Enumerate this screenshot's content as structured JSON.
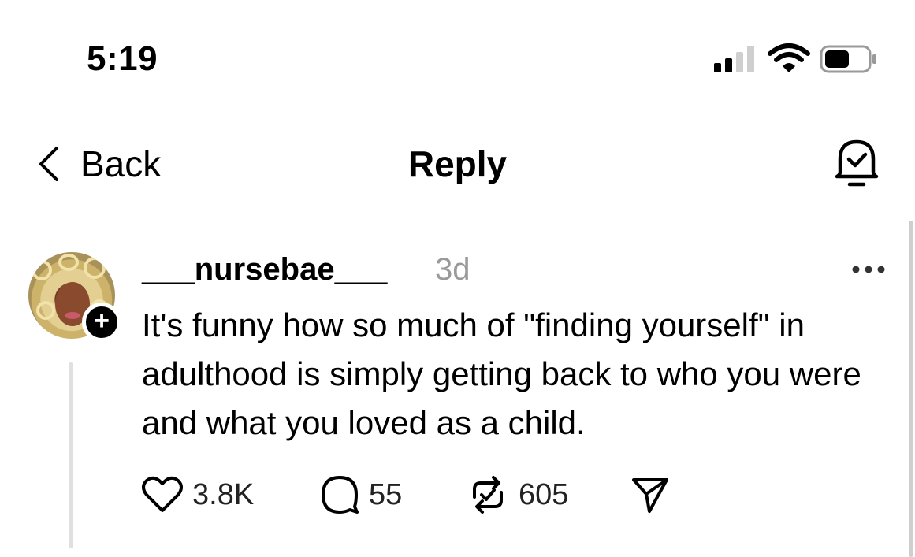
{
  "status_bar": {
    "time": "5:19",
    "icons": [
      "cellular-signal-icon",
      "wifi-icon",
      "battery-icon"
    ]
  },
  "nav": {
    "back_label": "Back",
    "title": "Reply",
    "right_icon": "notification-bell-check-icon"
  },
  "post": {
    "username": "___nursebae___",
    "time_ago": "3d",
    "text": "It's funny how so much of \"finding yourself\" in adulthood is simply getting back to who you were and what you loved as a child.",
    "likes": "3.8K",
    "replies": "55",
    "reposts": "605",
    "follow_badge": "+"
  },
  "colors": {
    "text": "#000000",
    "muted": "#9a9a9a",
    "thread_line": "#e0e0e0",
    "background": "#ffffff"
  }
}
